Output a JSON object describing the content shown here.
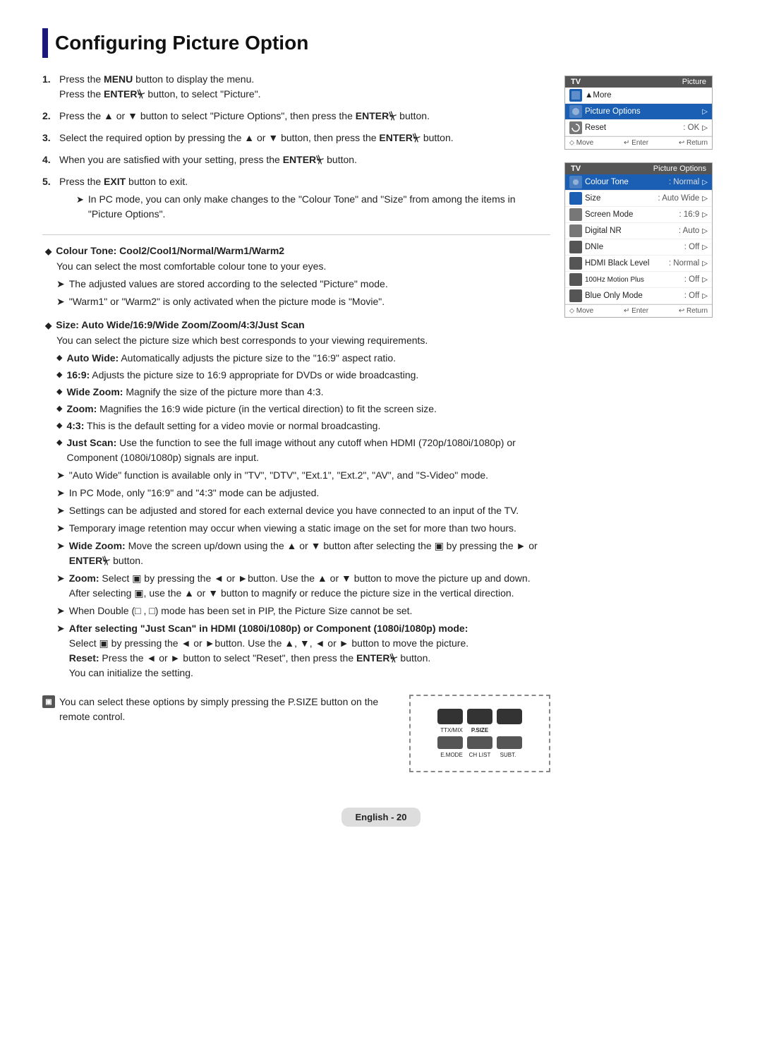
{
  "title": "Configuring Picture Option",
  "steps": [
    {
      "num": "1.",
      "lines": [
        "Press the <b>MENU</b> button to display the menu.",
        "Press the <b>ENTER</b> button, to select \"Picture\"."
      ]
    },
    {
      "num": "2.",
      "lines": [
        "Press the ▲ or ▼ button to select \"Picture Options\", then press the <b>ENTER</b> button."
      ]
    },
    {
      "num": "3.",
      "lines": [
        "Select the required option by pressing the ▲ or ▼ button, then press the <b>ENTER</b> button."
      ]
    },
    {
      "num": "4.",
      "lines": [
        "When you are satisfied with your setting, press the <b>ENTER</b> button."
      ]
    },
    {
      "num": "5.",
      "lines": [
        "Press the <b>EXIT</b> button to exit."
      ],
      "notes": [
        "In PC mode, you can only make changes to the \"Colour Tone\" and \"Size\" from among the items in \"Picture Options\"."
      ]
    }
  ],
  "panel1": {
    "header_left": "TV",
    "header_right": "Picture",
    "rows": [
      {
        "icon": "picture",
        "text": "▲More",
        "value": "",
        "arrow": ""
      },
      {
        "icon": "picture",
        "text": "Picture Options",
        "value": "",
        "arrow": "▷",
        "highlight": true
      },
      {
        "icon": "cog",
        "text": "Reset",
        "value": ": OK",
        "arrow": "▷"
      }
    ],
    "footer": [
      "⬦ Move",
      "↵ Enter",
      "↩ Return"
    ]
  },
  "panel2": {
    "header_left": "TV",
    "header_right": "Picture Options",
    "rows": [
      {
        "icon": "picture",
        "text": "Colour Tone",
        "value": ": Normal",
        "arrow": "▷",
        "highlight": true
      },
      {
        "icon": "picture",
        "text": "Size",
        "value": ": Auto Wide",
        "arrow": "▷"
      },
      {
        "icon": "cog",
        "text": "Screen Mode",
        "value": ": 16:9",
        "arrow": "▷"
      },
      {
        "icon": "cog",
        "text": "Digital NR",
        "value": ": Auto",
        "arrow": "▷"
      },
      {
        "icon": "cog",
        "text": "DNIe",
        "value": ": Off",
        "arrow": "▷"
      },
      {
        "icon": "cog",
        "text": "HDMI Black Level",
        "value": ": Normal",
        "arrow": "▷"
      },
      {
        "icon": "cog",
        "text": "100Hz Motion Plus",
        "value": ": Off",
        "arrow": "▷"
      },
      {
        "icon": "cog",
        "text": "Blue Only Mode",
        "value": ": Off",
        "arrow": "▷"
      }
    ],
    "footer": [
      "⬦ Move",
      "↵ Enter",
      "↩ Return"
    ]
  },
  "bullet_sections": [
    {
      "title": "Colour Tone: Cool2/Cool1/Normal/Warm1/Warm2",
      "desc": "You can select the most comfortable colour tone to your eyes.",
      "notes": [
        "The adjusted values are stored according to the selected \"Picture\" mode.",
        "\"Warm1\" or \"Warm2\" is only activated when the picture mode is \"Movie\"."
      ]
    },
    {
      "title": "Size: Auto Wide/16:9/Wide Zoom/Zoom/4:3/Just Scan",
      "desc": "You can select the picture size which best corresponds to your viewing requirements."
    }
  ],
  "size_subbullets": [
    {
      "label": "Auto Wide:",
      "text": "Automatically adjusts the picture size to the \"16:9\" aspect ratio."
    },
    {
      "label": "16:9:",
      "text": "Adjusts the picture size to 16:9 appropriate for DVDs or wide broadcasting."
    },
    {
      "label": "Wide Zoom:",
      "text": "Magnify the size of the picture more than 4:3."
    },
    {
      "label": "Zoom:",
      "text": "Magnifies the 16:9 wide picture (in the vertical direction) to fit the screen size."
    },
    {
      "label": "4:3:",
      "text": "This is the default setting for a video movie or normal broadcasting."
    },
    {
      "label": "Just Scan:",
      "text": "Use the function to see the full image without any cutoff when HDMI (720p/1080i/1080p) or Component (1080i/1080p) signals are input."
    }
  ],
  "size_notes": [
    "\"Auto Wide\" function is available only in \"TV\", \"DTV\", \"Ext.1\", \"Ext.2\", \"AV\", and \"S-Video\" mode.",
    "In PC Mode, only \"16:9\" and \"4:3\" mode can be adjusted.",
    "Settings can be adjusted and stored for each external device you have connected to an input of the TV.",
    "Temporary image retention may occur when viewing a static image on the set for more than two hours.",
    "Wide Zoom: Move the screen up/down using the ▲ or ▼ button after selecting the ▣ by pressing the ► or ENTER button.",
    "Zoom: Select ▣ by pressing the ◄ or ►button. Use the ▲ or ▼ button to move the picture up and down. After selecting ▣, use the ▲ or ▼ button to magnify or reduce the picture size in the vertical direction.",
    "When Double (□ , □) mode has been set in PIP, the Picture Size cannot be set.",
    "After selecting \"Just Scan\" in HDMI (1080i/1080p) or Component (1080i/1080p) mode: Select ▣ by pressing the ◄ or ►button. Use the ▲, ▼, ◄ or ► button to move the picture. Reset: Press the ◄ or ► button to select \"Reset\", then press the ENTER button. You can initialize the setting."
  ],
  "bottom_note": "You can select these options by simply pressing the P.SIZE button on the remote control.",
  "remote_buttons": {
    "row1": [
      "TTX/MIX",
      "P.SIZE",
      ""
    ],
    "row2": [
      "E.MODE",
      "CH LIST",
      "SUBT."
    ]
  },
  "footer": "English - 20"
}
